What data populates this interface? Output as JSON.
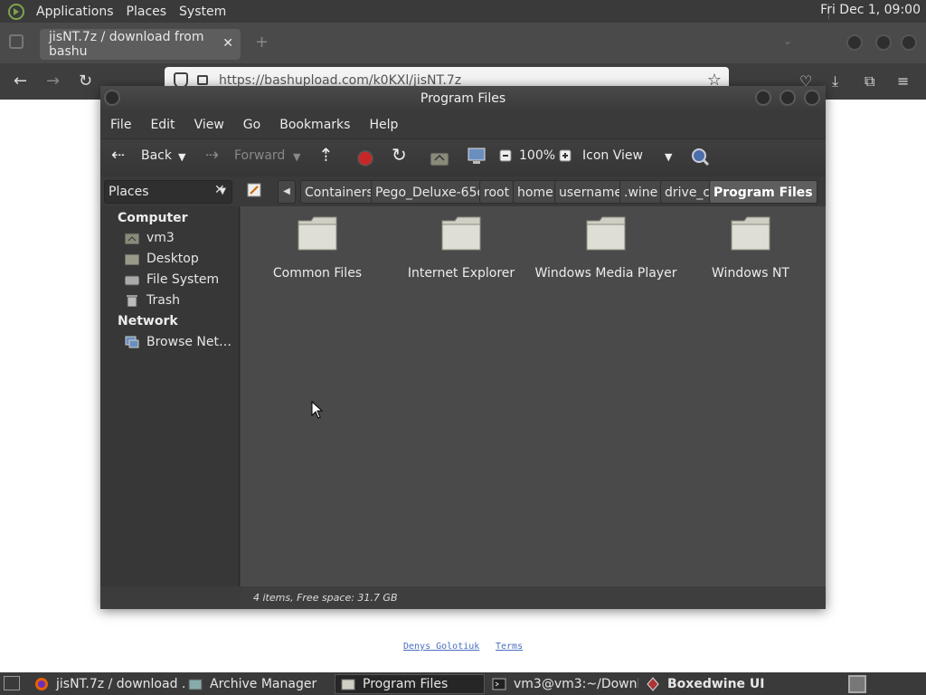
{
  "top_panel": {
    "menus": [
      "Applications",
      "Places",
      "System"
    ],
    "clock": "Fri Dec 1, 09:00"
  },
  "firefox": {
    "tab_title": "jisNT.7z / download from bashu",
    "url": "https://bashupload.com/k0KXl/jisNT.7z"
  },
  "page_links": [
    "Denys Golotiuk",
    "Terms"
  ],
  "window": {
    "title": "Program Files",
    "menus": [
      "File",
      "Edit",
      "View",
      "Go",
      "Bookmarks",
      "Help"
    ],
    "toolbar": {
      "back": "Back",
      "forward": "Forward",
      "zoom": "100%",
      "view_mode": "Icon View"
    },
    "places_label": "Places",
    "breadcrumbs": [
      "Containers",
      "Pego_Deluxe-65d",
      "root",
      "home",
      "username",
      ".wine",
      "drive_c",
      "Program Files"
    ],
    "sidebar": {
      "computer_heading": "Computer",
      "computer_items": [
        "vm3",
        "Desktop",
        "File System",
        "Trash"
      ],
      "network_heading": "Network",
      "network_items": [
        "Browse Net…"
      ]
    },
    "folders": [
      "Common Files",
      "Internet Explorer",
      "Windows Media Player",
      "Windows NT"
    ],
    "status": "4 items, Free space: 31.7 GB"
  },
  "taskbar": {
    "tasks": [
      "jisNT.7z / download ...",
      "Archive Manager",
      "Program Files",
      "vm3@vm3:~/Downl...",
      "Boxedwine UI"
    ]
  }
}
